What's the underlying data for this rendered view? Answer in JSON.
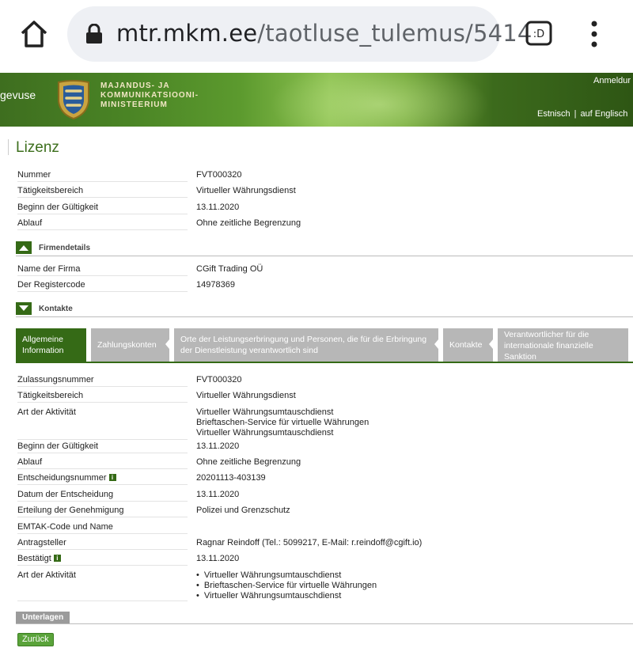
{
  "browser": {
    "url_domain": "mtr.mkm.ee",
    "url_path": "/taotluse_tulemus/5414",
    "tab_icon_label": ":D"
  },
  "header": {
    "left_text": "gevuse",
    "ministry_lines": [
      "Majandus- ja",
      "Kommunikatsiooni-",
      "ministeerium"
    ],
    "login": "Anmeldur",
    "lang_et": "Estnisch",
    "lang_sep": "|",
    "lang_de": "auf Englisch"
  },
  "page": {
    "title": "Lizenz",
    "summary": [
      {
        "label": "Nummer",
        "value": "FVT000320"
      },
      {
        "label": "Tätigkeitsbereich",
        "value": "Virtueller Währungsdienst"
      },
      {
        "label": "Beginn der Gültigkeit",
        "value": "13.11.2020"
      },
      {
        "label": "Ablauf",
        "value": "Ohne zeitliche Begrenzung"
      }
    ],
    "firm_section": "Firmendetails",
    "firm": [
      {
        "label": "Name der Firma",
        "value": "CGift Trading OÜ"
      },
      {
        "label": "Der Registercode",
        "value": "14978369"
      }
    ],
    "contacts_section": "Kontakte",
    "tabs": [
      {
        "label": "Allgemeine Information",
        "active": true
      },
      {
        "label": "Zahlungskonten",
        "active": false
      },
      {
        "label": "Orte der Leistungserbringung und Personen, die für die Erbringung der Dienstleistung verantwortlich sind",
        "active": false
      },
      {
        "label": "Kontakte",
        "active": false
      },
      {
        "label": "Verantwortlicher für die internationale finanzielle Sanktion",
        "active": false
      }
    ],
    "details": {
      "zulassungsnummer_label": "Zulassungsnummer",
      "zulassungsnummer": "FVT000320",
      "taetigkeit_label": "Tätigkeitsbereich",
      "taetigkeit": "Virtueller Währungsdienst",
      "art_label": "Art der Aktivität",
      "art_lines": [
        "Virtueller Währungsumtauschdienst",
        "Brieftaschen-Service für virtuelle Währungen",
        "Virtueller Währungsumtauschdienst"
      ],
      "beginn_label": "Beginn der Gültigkeit",
      "beginn": "13.11.2020",
      "ablauf_label": "Ablauf",
      "ablauf": "Ohne zeitliche Begrenzung",
      "entscheidungsnummer_label": "Entscheidungsnummer",
      "entscheidungsnummer": "20201113-403139",
      "datum_label": "Datum der Entscheidung",
      "datum": "13.11.2020",
      "erteilung_label": "Erteilung der Genehmigung",
      "erteilung": "Polizei und Grenzschutz",
      "emtak_label": "EMTAK-Code und Name",
      "antragsteller_label": "Antragsteller",
      "antragsteller": "Ragnar Reindoff (Tel.: 5099217, E-Mail: r.reindoff@cgift.io)",
      "bestaetigt_label": "Bestätigt",
      "bestaetigt": "13.11.2020",
      "art2_label": "Art der Aktivität",
      "art2_items": [
        "Virtueller Währungsumtauschdienst",
        "Brieftaschen-Service für virtuelle Währungen",
        "Virtueller Währungsumtauschdienst"
      ]
    },
    "unterlagen": "Unterlagen",
    "back_button": "Zurück",
    "info_icon_glyph": "i"
  },
  "colors": {
    "accent_green": "#356a16",
    "title_green": "#3d6f1d",
    "inactive_tab": "#b7b7b7",
    "button_green": "#5aa33a"
  }
}
